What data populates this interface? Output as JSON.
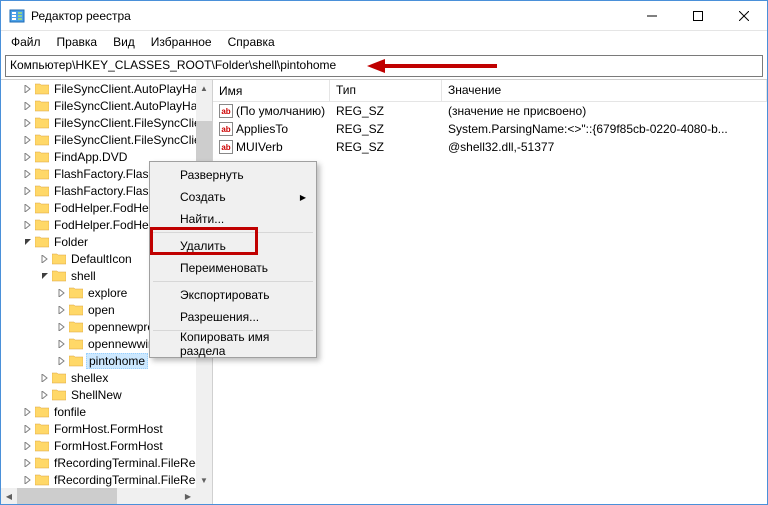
{
  "window": {
    "title": "Редактор реестра"
  },
  "menubar": [
    "Файл",
    "Правка",
    "Вид",
    "Избранное",
    "Справка"
  ],
  "addressbar": {
    "value": "Компьютер\\HKEY_CLASSES_ROOT\\Folder\\shell\\pintohome"
  },
  "tree": [
    {
      "indent": 1,
      "exp": "closed",
      "label": "FileSyncClient.AutoPlayHandler"
    },
    {
      "indent": 1,
      "exp": "closed",
      "label": "FileSyncClient.AutoPlayHandler"
    },
    {
      "indent": 1,
      "exp": "closed",
      "label": "FileSyncClient.FileSyncClient"
    },
    {
      "indent": 1,
      "exp": "closed",
      "label": "FileSyncClient.FileSyncClient"
    },
    {
      "indent": 1,
      "exp": "closed",
      "label": "FindApp.DVD"
    },
    {
      "indent": 1,
      "exp": "closed",
      "label": "FlashFactory.FlashFactory"
    },
    {
      "indent": 1,
      "exp": "closed",
      "label": "FlashFactory.FlashFactory"
    },
    {
      "indent": 1,
      "exp": "closed",
      "label": "FodHelper.FodHelper"
    },
    {
      "indent": 1,
      "exp": "closed",
      "label": "FodHelper.FodHelper"
    },
    {
      "indent": 1,
      "exp": "open",
      "label": "Folder"
    },
    {
      "indent": 2,
      "exp": "closed",
      "label": "DefaultIcon"
    },
    {
      "indent": 2,
      "exp": "open",
      "label": "shell"
    },
    {
      "indent": 3,
      "exp": "closed",
      "label": "explore"
    },
    {
      "indent": 3,
      "exp": "closed",
      "label": "open"
    },
    {
      "indent": 3,
      "exp": "closed",
      "label": "opennewprocess"
    },
    {
      "indent": 3,
      "exp": "closed",
      "label": "opennewwindow"
    },
    {
      "indent": 3,
      "exp": "closed",
      "label": "pintohome",
      "selected": true
    },
    {
      "indent": 2,
      "exp": "closed",
      "label": "shellex"
    },
    {
      "indent": 2,
      "exp": "closed",
      "label": "ShellNew"
    },
    {
      "indent": 1,
      "exp": "closed",
      "label": "fonfile"
    },
    {
      "indent": 1,
      "exp": "closed",
      "label": "FormHost.FormHost"
    },
    {
      "indent": 1,
      "exp": "closed",
      "label": "FormHost.FormHost"
    },
    {
      "indent": 1,
      "exp": "closed",
      "label": "fRecordingTerminal.FileRecording"
    },
    {
      "indent": 1,
      "exp": "closed",
      "label": "fRecordingTerminal.FileRecording"
    }
  ],
  "list": {
    "headers": {
      "name": "Имя",
      "type": "Тип",
      "value": "Значение"
    },
    "rows": [
      {
        "name": "(По умолчанию)",
        "type": "REG_SZ",
        "value": "(значение не присвоено)"
      },
      {
        "name": "AppliesTo",
        "type": "REG_SZ",
        "value": "System.ParsingName:<>\"::{679f85cb-0220-4080-b..."
      },
      {
        "name": "MUIVerb",
        "type": "REG_SZ",
        "value": "@shell32.dll,-51377"
      }
    ]
  },
  "context_menu": {
    "items": [
      {
        "label": "Развернуть"
      },
      {
        "label": "Создать",
        "submenu": true
      },
      {
        "label": "Найти..."
      },
      {
        "sep": true
      },
      {
        "label": "Удалить",
        "highlight": true
      },
      {
        "label": "Переименовать"
      },
      {
        "sep": true
      },
      {
        "label": "Экспортировать"
      },
      {
        "label": "Разрешения..."
      },
      {
        "sep": true
      },
      {
        "label": "Копировать имя раздела"
      }
    ]
  },
  "icons": {
    "string_tag": "ab"
  }
}
